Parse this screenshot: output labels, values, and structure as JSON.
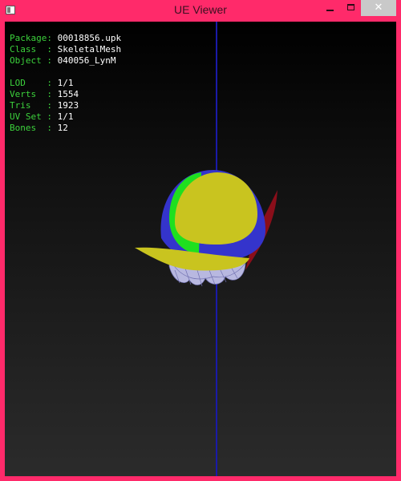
{
  "window": {
    "title": "UE Viewer",
    "app_icon": "app-icon",
    "controls": {
      "minimize_icon": "minimize-icon",
      "maximize_icon": "maximize-icon",
      "close_icon": "close-icon",
      "close_glyph": "✕"
    },
    "colors": {
      "frame": "#ff2a6a",
      "close_bg": "#c9c9c9",
      "label": "#3cd23c",
      "value": "#ffffff",
      "axis": "#1a1aa8"
    }
  },
  "info": {
    "package": {
      "label": "Package:",
      "value": "00018856.upk"
    },
    "class": {
      "label": "Class  :",
      "value": "SkeletalMesh"
    },
    "object": {
      "label": "Object :",
      "value": "040056_LynM"
    },
    "lod": {
      "label": "LOD    :",
      "value": "1/1"
    },
    "verts": {
      "label": "Verts  :",
      "value": "1554"
    },
    "tris": {
      "label": "Tris   :",
      "value": "1923"
    },
    "uvset": {
      "label": "UV Set :",
      "value": "1/1"
    },
    "bones": {
      "label": "Bones  :",
      "value": "12"
    }
  }
}
